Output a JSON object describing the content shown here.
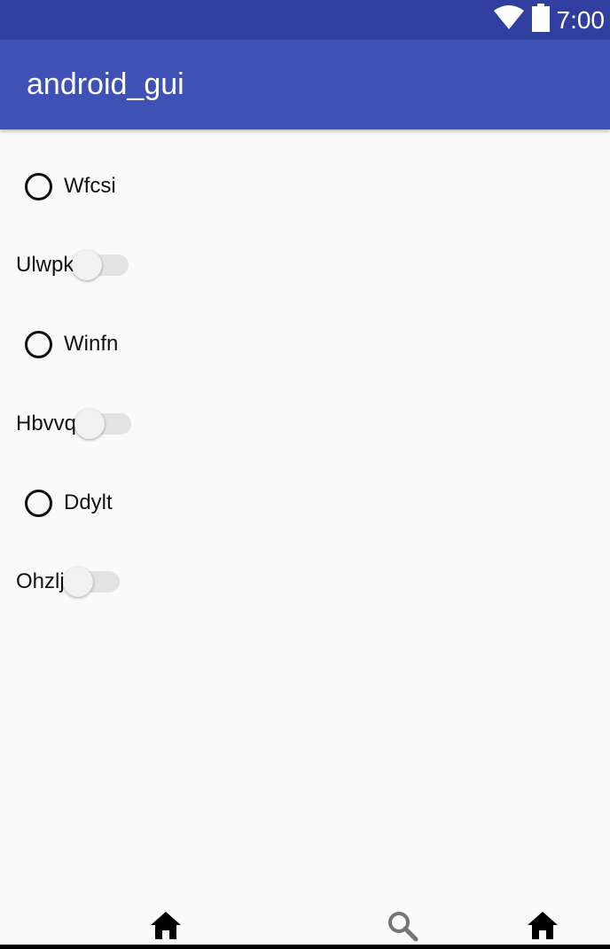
{
  "status_bar": {
    "time": "7:00",
    "icons": [
      "wifi-icon",
      "battery-icon"
    ]
  },
  "app_bar": {
    "title": "android_gui"
  },
  "controls": [
    {
      "type": "radio",
      "label": "Wfcsi",
      "checked": false
    },
    {
      "type": "switch",
      "label": "Ulwpk",
      "on": false
    },
    {
      "type": "radio",
      "label": "Winfn",
      "checked": false
    },
    {
      "type": "switch",
      "label": "Hbvvq",
      "on": false
    },
    {
      "type": "radio",
      "label": "Ddylt",
      "checked": false
    },
    {
      "type": "switch",
      "label": "Ohzlj",
      "on": false
    }
  ],
  "bottom_nav": {
    "icons": [
      "home-icon",
      "search-icon",
      "home-icon"
    ]
  },
  "colors": {
    "status_bar": "#303f9f",
    "app_bar": "#3f51b5",
    "background": "#fafafa"
  }
}
